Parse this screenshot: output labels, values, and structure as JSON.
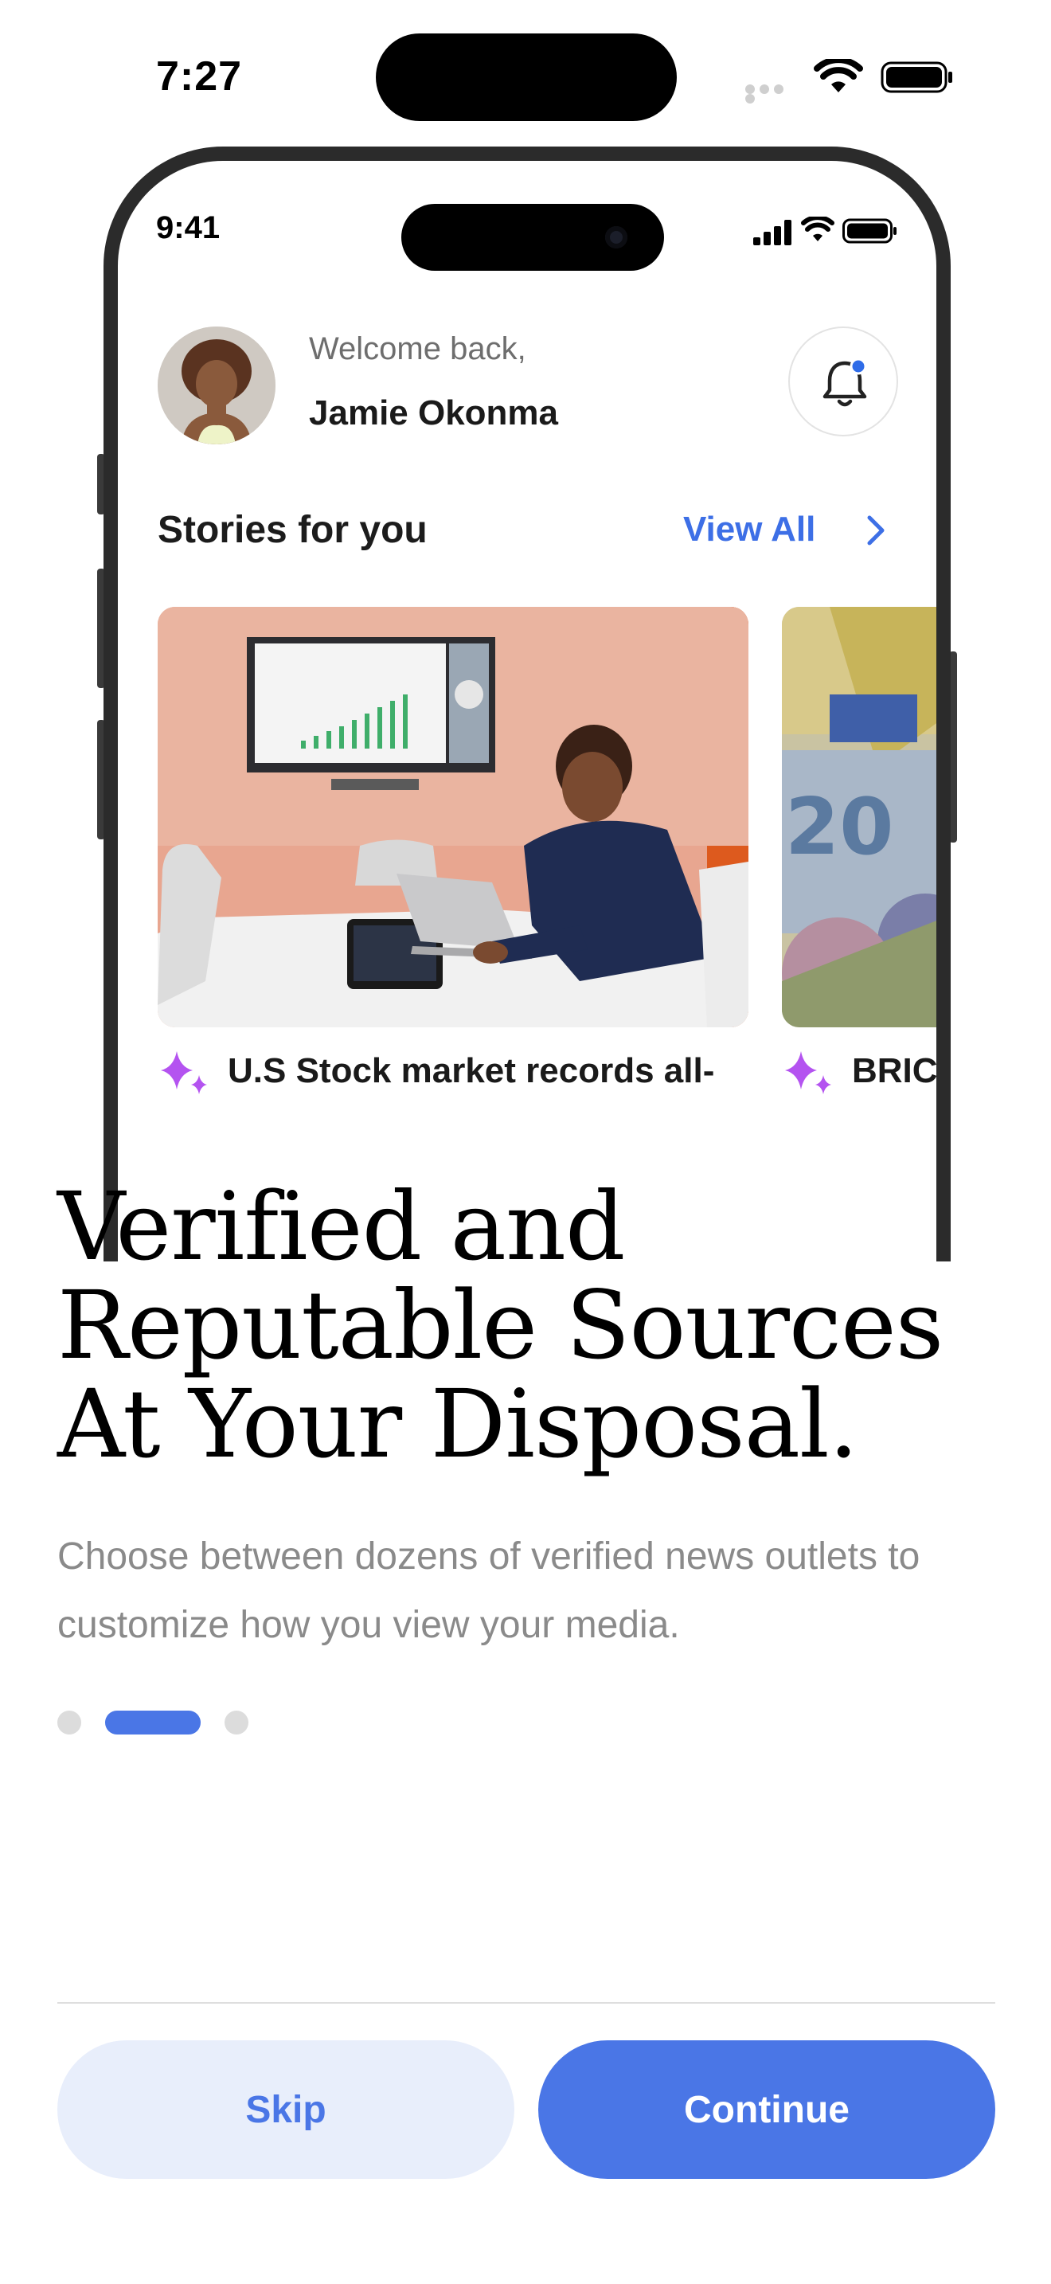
{
  "device_status": {
    "time": "7:27",
    "icons": [
      "signal-dots-icon",
      "wifi-icon",
      "battery-icon"
    ]
  },
  "mockup": {
    "status_time": "9:41",
    "greeting": "Welcome back,",
    "user_name": "Jamie Okonma",
    "section_title": "Stories for you",
    "view_all_label": "View All",
    "stories": [
      {
        "caption": "U.S Stock market records all-",
        "image": "man-in-suit-with-laptop-in-meeting-room"
      },
      {
        "caption": "BRICS",
        "image": "euro-banknotes"
      }
    ],
    "icons": [
      "avatar",
      "bell-icon",
      "chevron-right-icon",
      "sparkle-icon"
    ]
  },
  "onboarding": {
    "headline_lines": [
      "Verified and",
      "Reputable Sources",
      "At Your Disposal."
    ],
    "description_lines": [
      "Choose between dozens of verified news outlets to",
      "customize how you view your media."
    ],
    "page_indicator": {
      "total": 3,
      "current": 2
    }
  },
  "actions": {
    "skip_label": "Skip",
    "continue_label": "Continue"
  },
  "colors": {
    "accent": "#4a76e6",
    "skip_bg": "#e8eefb",
    "link": "#3d6fe6",
    "sparkle": "#b453f0",
    "muted_text": "#8a8a8a"
  }
}
